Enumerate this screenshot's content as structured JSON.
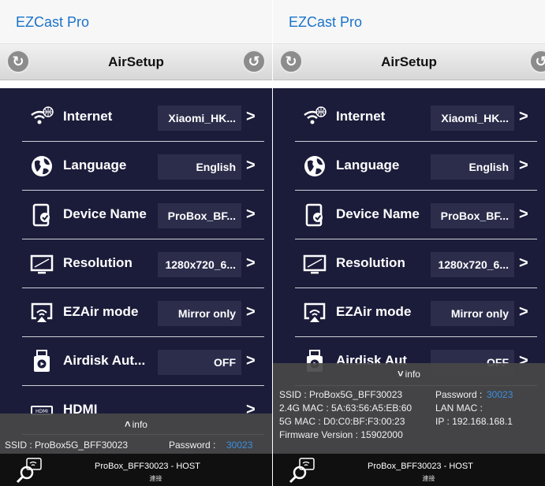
{
  "app_title": "EZCast Pro",
  "toolbar": {
    "title": "AirSetup",
    "left_icon": "refresh-icon",
    "right_icon": "back-icon"
  },
  "menu": [
    {
      "id": "internet",
      "icon": "wifi-globe-icon",
      "label": "Internet",
      "value": "Xiaomi_HK..."
    },
    {
      "id": "language",
      "icon": "globe-icon",
      "label": "Language",
      "value": "English"
    },
    {
      "id": "device-name",
      "icon": "device-edit-icon",
      "label": "Device Name",
      "value": "ProBox_BF..."
    },
    {
      "id": "resolution",
      "icon": "monitor-icon",
      "label": "Resolution",
      "value": "1280x720_6..."
    },
    {
      "id": "ezair-mode",
      "icon": "airplay-icon",
      "label": "EZAir mode",
      "value": "Mirror only"
    },
    {
      "id": "airdisk",
      "icon": "airdisk-icon",
      "label": "Airdisk Aut...",
      "value": "OFF"
    },
    {
      "id": "hdmi",
      "icon": "hdmi-icon",
      "label": "HDMI",
      "value": ""
    }
  ],
  "menu_right": {
    "airdisk_label": "Airdisk Aut",
    "airdisk_value": "OFF"
  },
  "chevron": ">",
  "info": {
    "toggle_label": "info",
    "ssid": "SSID : ProBox5G_BFF30023",
    "password_label": "Password :",
    "password_value": "30023",
    "mac_24g": "2.4G MAC : 5A:63:56:A5:EB:60",
    "lan_mac": "LAN MAC :",
    "mac_5g": "5G MAC : D0:C0:BF:F3:00:23",
    "ip": "IP : 192.168.168.1",
    "firmware": "Firmware Version : 15902000"
  },
  "bottom_bar": {
    "title": "ProBox_BFF30023 - HOST",
    "subtitle": "連接",
    "icon": "search-cast-icon"
  }
}
